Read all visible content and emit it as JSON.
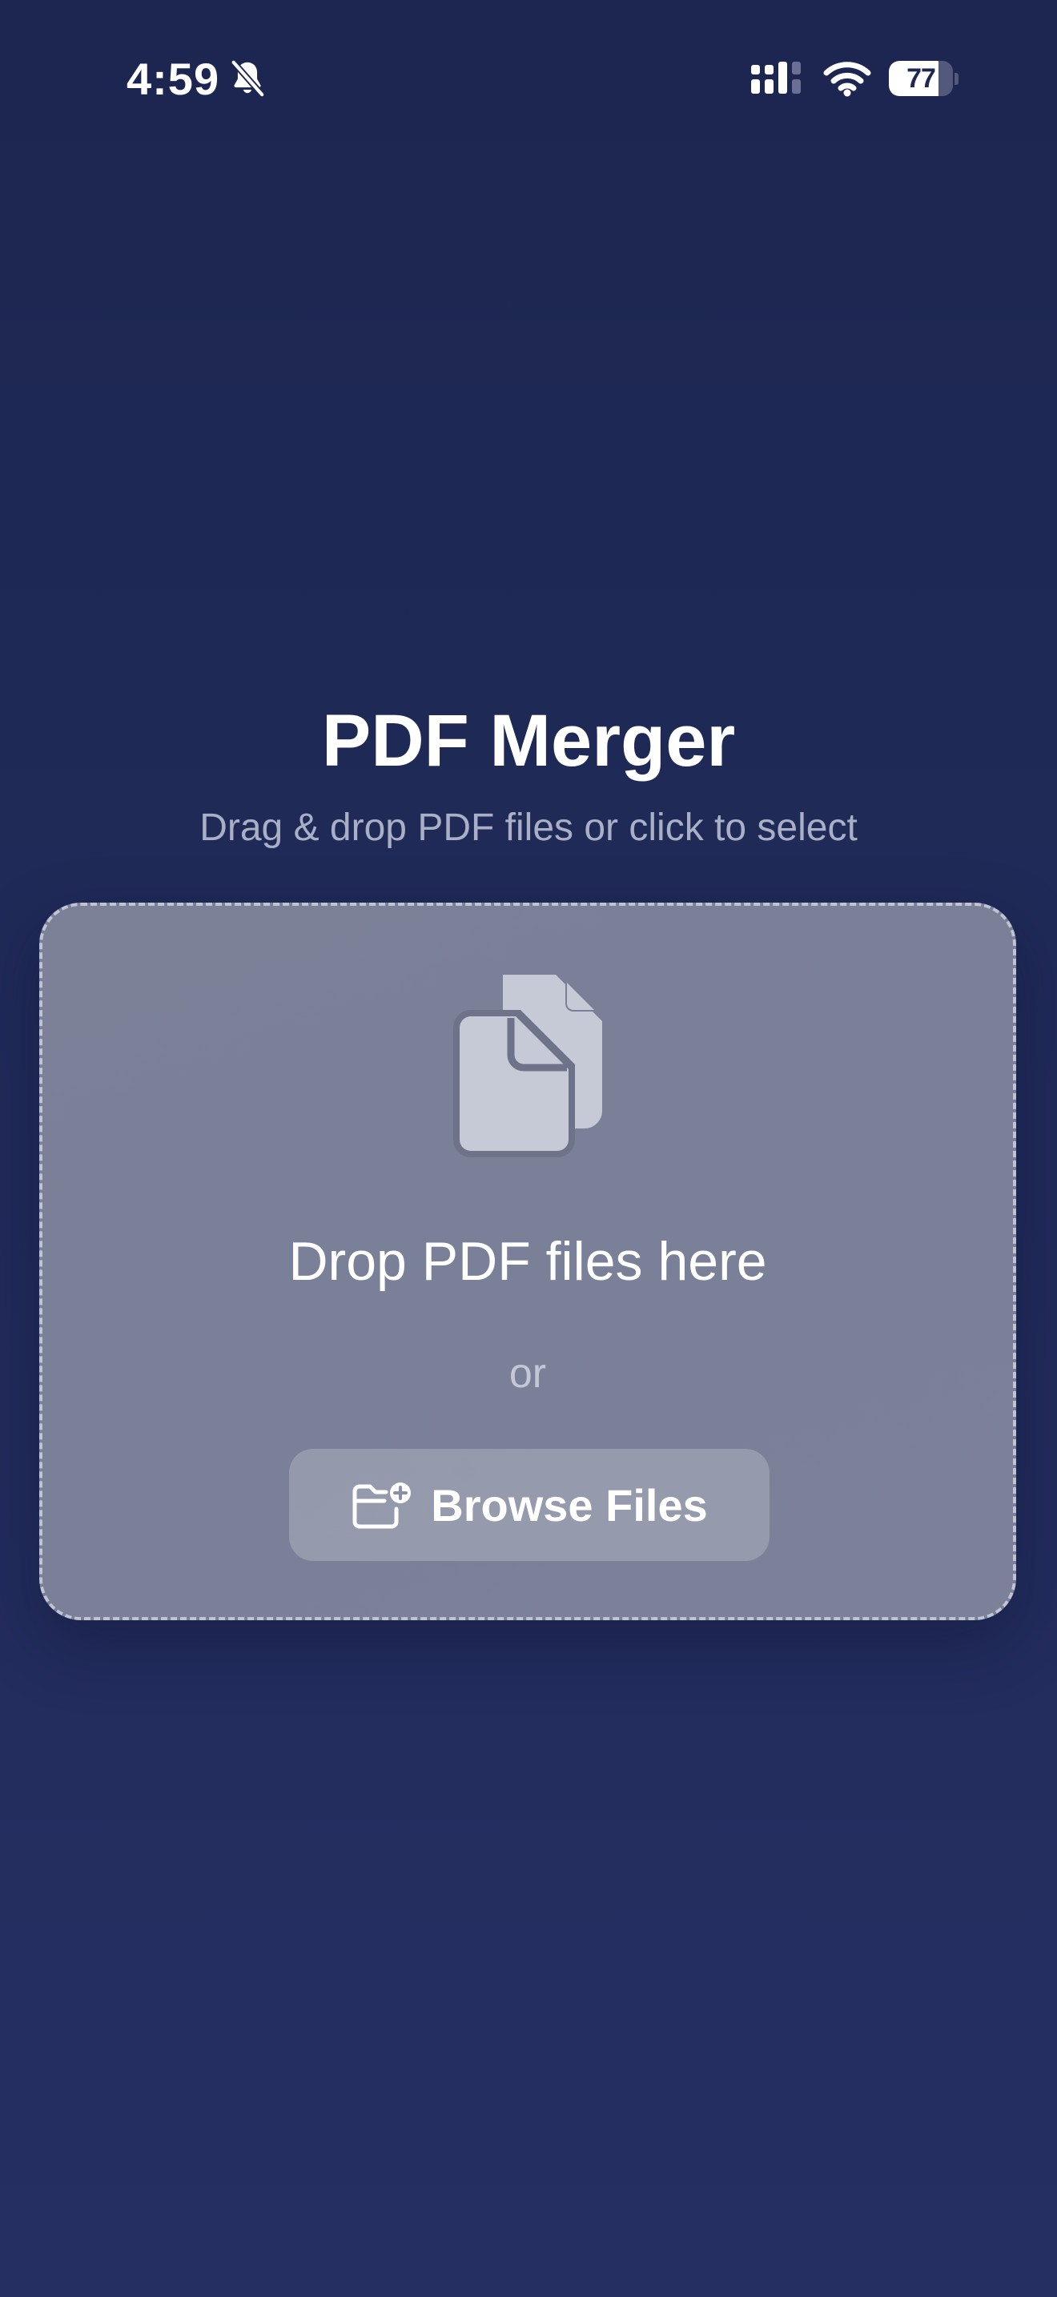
{
  "status_bar": {
    "time": "4:59",
    "battery_level": "77",
    "battery_fraction": 0.77,
    "icons": [
      "bell-slash-icon",
      "cellular-signal-icon",
      "wifi-icon",
      "battery-icon"
    ]
  },
  "header": {
    "title": "PDF Merger",
    "subtitle": "Drag & drop PDF files or click to select"
  },
  "drop_zone": {
    "icon": "documents-icon",
    "title": "Drop PDF files here",
    "or_text": "or",
    "browse_button": {
      "icon": "folder-plus-icon",
      "label": "Browse Files"
    }
  },
  "colors": {
    "background": "#1f2954",
    "card": "#7b8098",
    "subtitle": "#a9afc7",
    "icon_fill": "#c6c9d6",
    "icon_stroke": "#6e7389"
  }
}
